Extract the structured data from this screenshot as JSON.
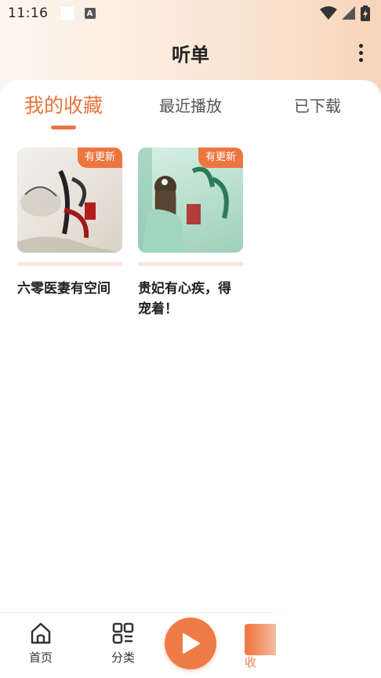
{
  "status_bar": {
    "time": "11:16",
    "icons": [
      "notification-square-icon",
      "a-app-icon",
      "wifi-icon",
      "signal-icon",
      "battery-icon"
    ]
  },
  "header": {
    "title": "听单",
    "more_icon": "more-vertical-icon"
  },
  "tabs": [
    {
      "label": "我的收藏",
      "active": true
    },
    {
      "label": "最近播放",
      "active": false
    },
    {
      "label": "已下载",
      "active": false
    }
  ],
  "books": [
    {
      "title": "六零医妻有空间",
      "badge": "有更新"
    },
    {
      "title": "贵妃有心疾，得宠着！",
      "badge": "有更新"
    }
  ],
  "bottom_nav": {
    "items": [
      {
        "label": "首页",
        "icon": "home-icon"
      },
      {
        "label": "分类",
        "icon": "category-grid-icon"
      }
    ],
    "play_icon": "play-icon",
    "partial_label": "收"
  },
  "colors": {
    "accent": "#ec7640",
    "header_gradient_start": "#fdf6ef",
    "header_gradient_end": "#f8d4b9",
    "text_primary": "#222222"
  }
}
